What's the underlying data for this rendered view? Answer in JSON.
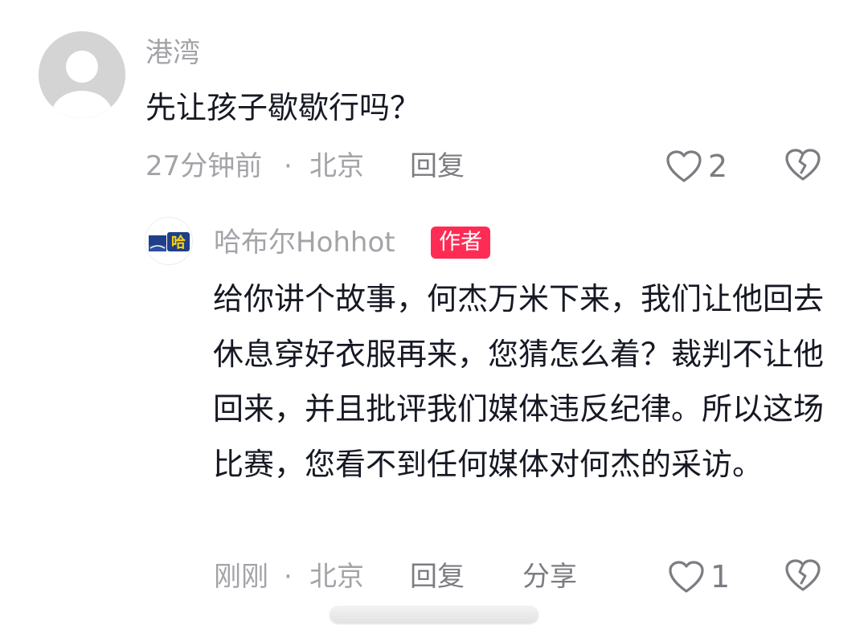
{
  "comment": {
    "username": "港湾",
    "text": "先让孩子歇歇行吗？",
    "time": "27分钟前",
    "separator": "·",
    "location": "北京",
    "reply_label": "回复",
    "like_count": "2"
  },
  "reply": {
    "username": "哈布尔Hohhot",
    "badge": "作者",
    "avatar_text": "哈",
    "text": "给你讲个故事，何杰万米下来，我们让他回去休息穿好衣服再来，您猜怎么着？裁判不让他回来，并且批评我们媒体违反纪律。所以这场比赛，您看不到任何媒体对何杰的采访。",
    "time": "刚刚",
    "separator": "·",
    "location": "北京",
    "reply_label": "回复",
    "share_label": "分享",
    "like_count": "1"
  },
  "colors": {
    "accent": "#fe2c55",
    "meta": "#a3a3a8",
    "text": "#161823"
  },
  "icons": [
    "default-avatar-icon",
    "heart-outline-icon",
    "broken-heart-icon",
    "channel-logo-icon"
  ]
}
